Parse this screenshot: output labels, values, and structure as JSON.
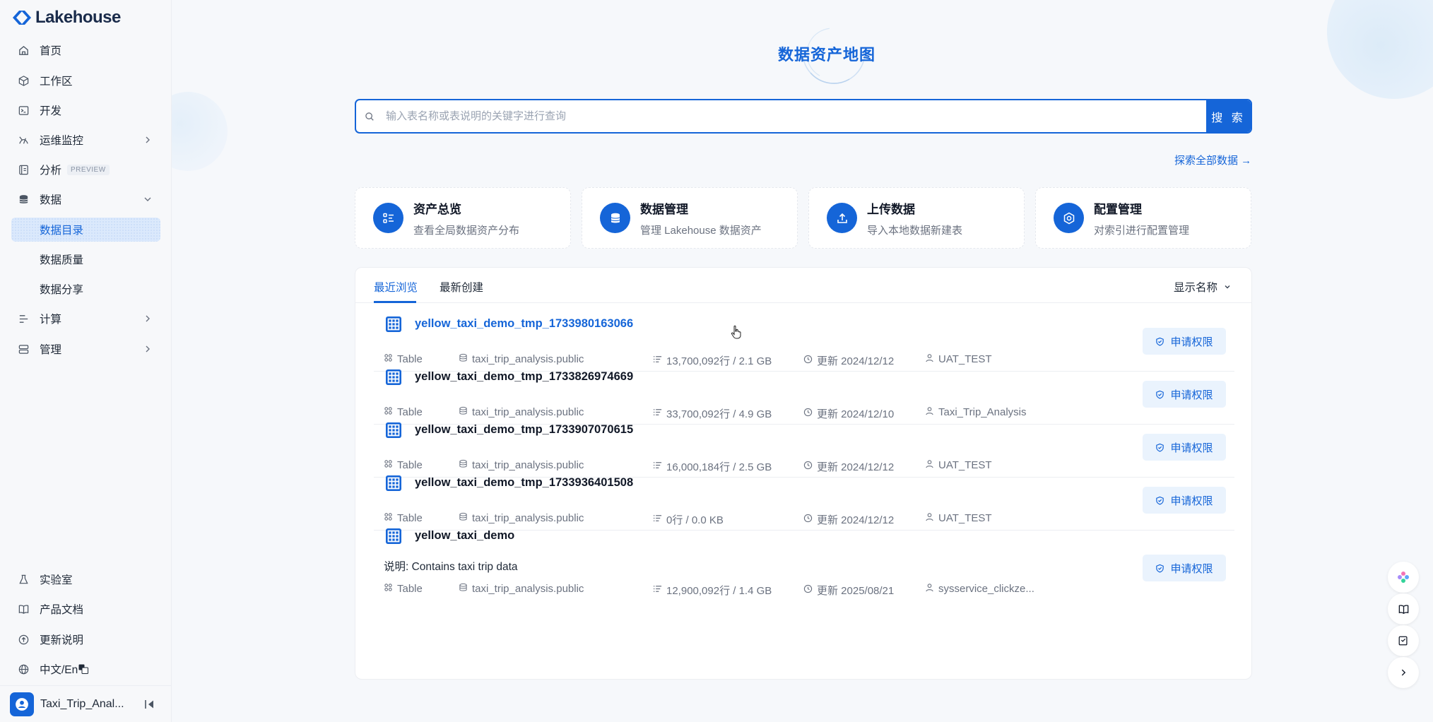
{
  "brand": {
    "name": "Lakehouse"
  },
  "sidebar": {
    "items": [
      {
        "label": "首页"
      },
      {
        "label": "工作区"
      },
      {
        "label": "开发"
      },
      {
        "label": "运维监控"
      },
      {
        "label": "分析",
        "badge": "PREVIEW"
      },
      {
        "label": "数据"
      },
      {
        "label": "计算"
      },
      {
        "label": "管理"
      }
    ],
    "data_sub": [
      {
        "label": "数据目录",
        "active": true
      },
      {
        "label": "数据质量"
      },
      {
        "label": "数据分享"
      }
    ],
    "bottom": [
      {
        "label": "实验室"
      },
      {
        "label": "产品文档"
      },
      {
        "label": "更新说明"
      },
      {
        "label": "中文/En"
      }
    ],
    "user": {
      "name": "Taxi_Trip_Anal..."
    }
  },
  "main": {
    "title": "数据资产地图",
    "search": {
      "placeholder": "输入表名称或表说明的关键字进行查询",
      "button": "搜 索"
    },
    "explore_link": "探索全部数据 →",
    "cards": [
      {
        "title": "资产总览",
        "desc": "查看全局数据资产分布",
        "icon": "asset-overview-icon"
      },
      {
        "title": "数据管理",
        "desc": "管理 Lakehouse 数据资产",
        "icon": "database-icon"
      },
      {
        "title": "上传数据",
        "desc": "导入本地数据新建表",
        "icon": "upload-icon"
      },
      {
        "title": "配置管理",
        "desc": "对索引进行配置管理",
        "icon": "settings-icon"
      }
    ],
    "tabs": [
      {
        "label": "最近浏览",
        "active": true
      },
      {
        "label": "最新创建"
      }
    ],
    "display_select": "显示名称",
    "rows": [
      {
        "name": "yellow_taxi_demo_tmp_1733980163066",
        "type": "Table",
        "schema": "taxi_trip_analysis.public",
        "stats": "13,700,092行 / 2.1 GB",
        "updated": "更新 2024/12/12",
        "owner": "UAT_TEST",
        "apply": "申请权限"
      },
      {
        "name": "yellow_taxi_demo_tmp_1733826974669",
        "type": "Table",
        "schema": "taxi_trip_analysis.public",
        "stats": "33,700,092行 / 4.9 GB",
        "updated": "更新 2024/12/10",
        "owner": "Taxi_Trip_Analysis",
        "apply": "申请权限"
      },
      {
        "name": "yellow_taxi_demo_tmp_1733907070615",
        "type": "Table",
        "schema": "taxi_trip_analysis.public",
        "stats": "16,000,184行 / 2.5 GB",
        "updated": "更新 2024/12/12",
        "owner": "UAT_TEST",
        "apply": "申请权限"
      },
      {
        "name": "yellow_taxi_demo_tmp_1733936401508",
        "type": "Table",
        "schema": "taxi_trip_analysis.public",
        "stats": "0行 / 0.0 KB",
        "updated": "更新 2024/12/12",
        "owner": "UAT_TEST",
        "apply": "申请权限"
      },
      {
        "name": "yellow_taxi_demo",
        "description": "说明: Contains taxi trip data",
        "type": "Table",
        "schema": "taxi_trip_analysis.public",
        "stats": "12,900,092行 / 1.4 GB",
        "updated": "更新 2025/08/21",
        "owner": "sysservice_clickze...",
        "apply": "申请权限"
      }
    ]
  },
  "colors": {
    "accent": "#1565d8",
    "accent_light": "#eaf3fd"
  }
}
